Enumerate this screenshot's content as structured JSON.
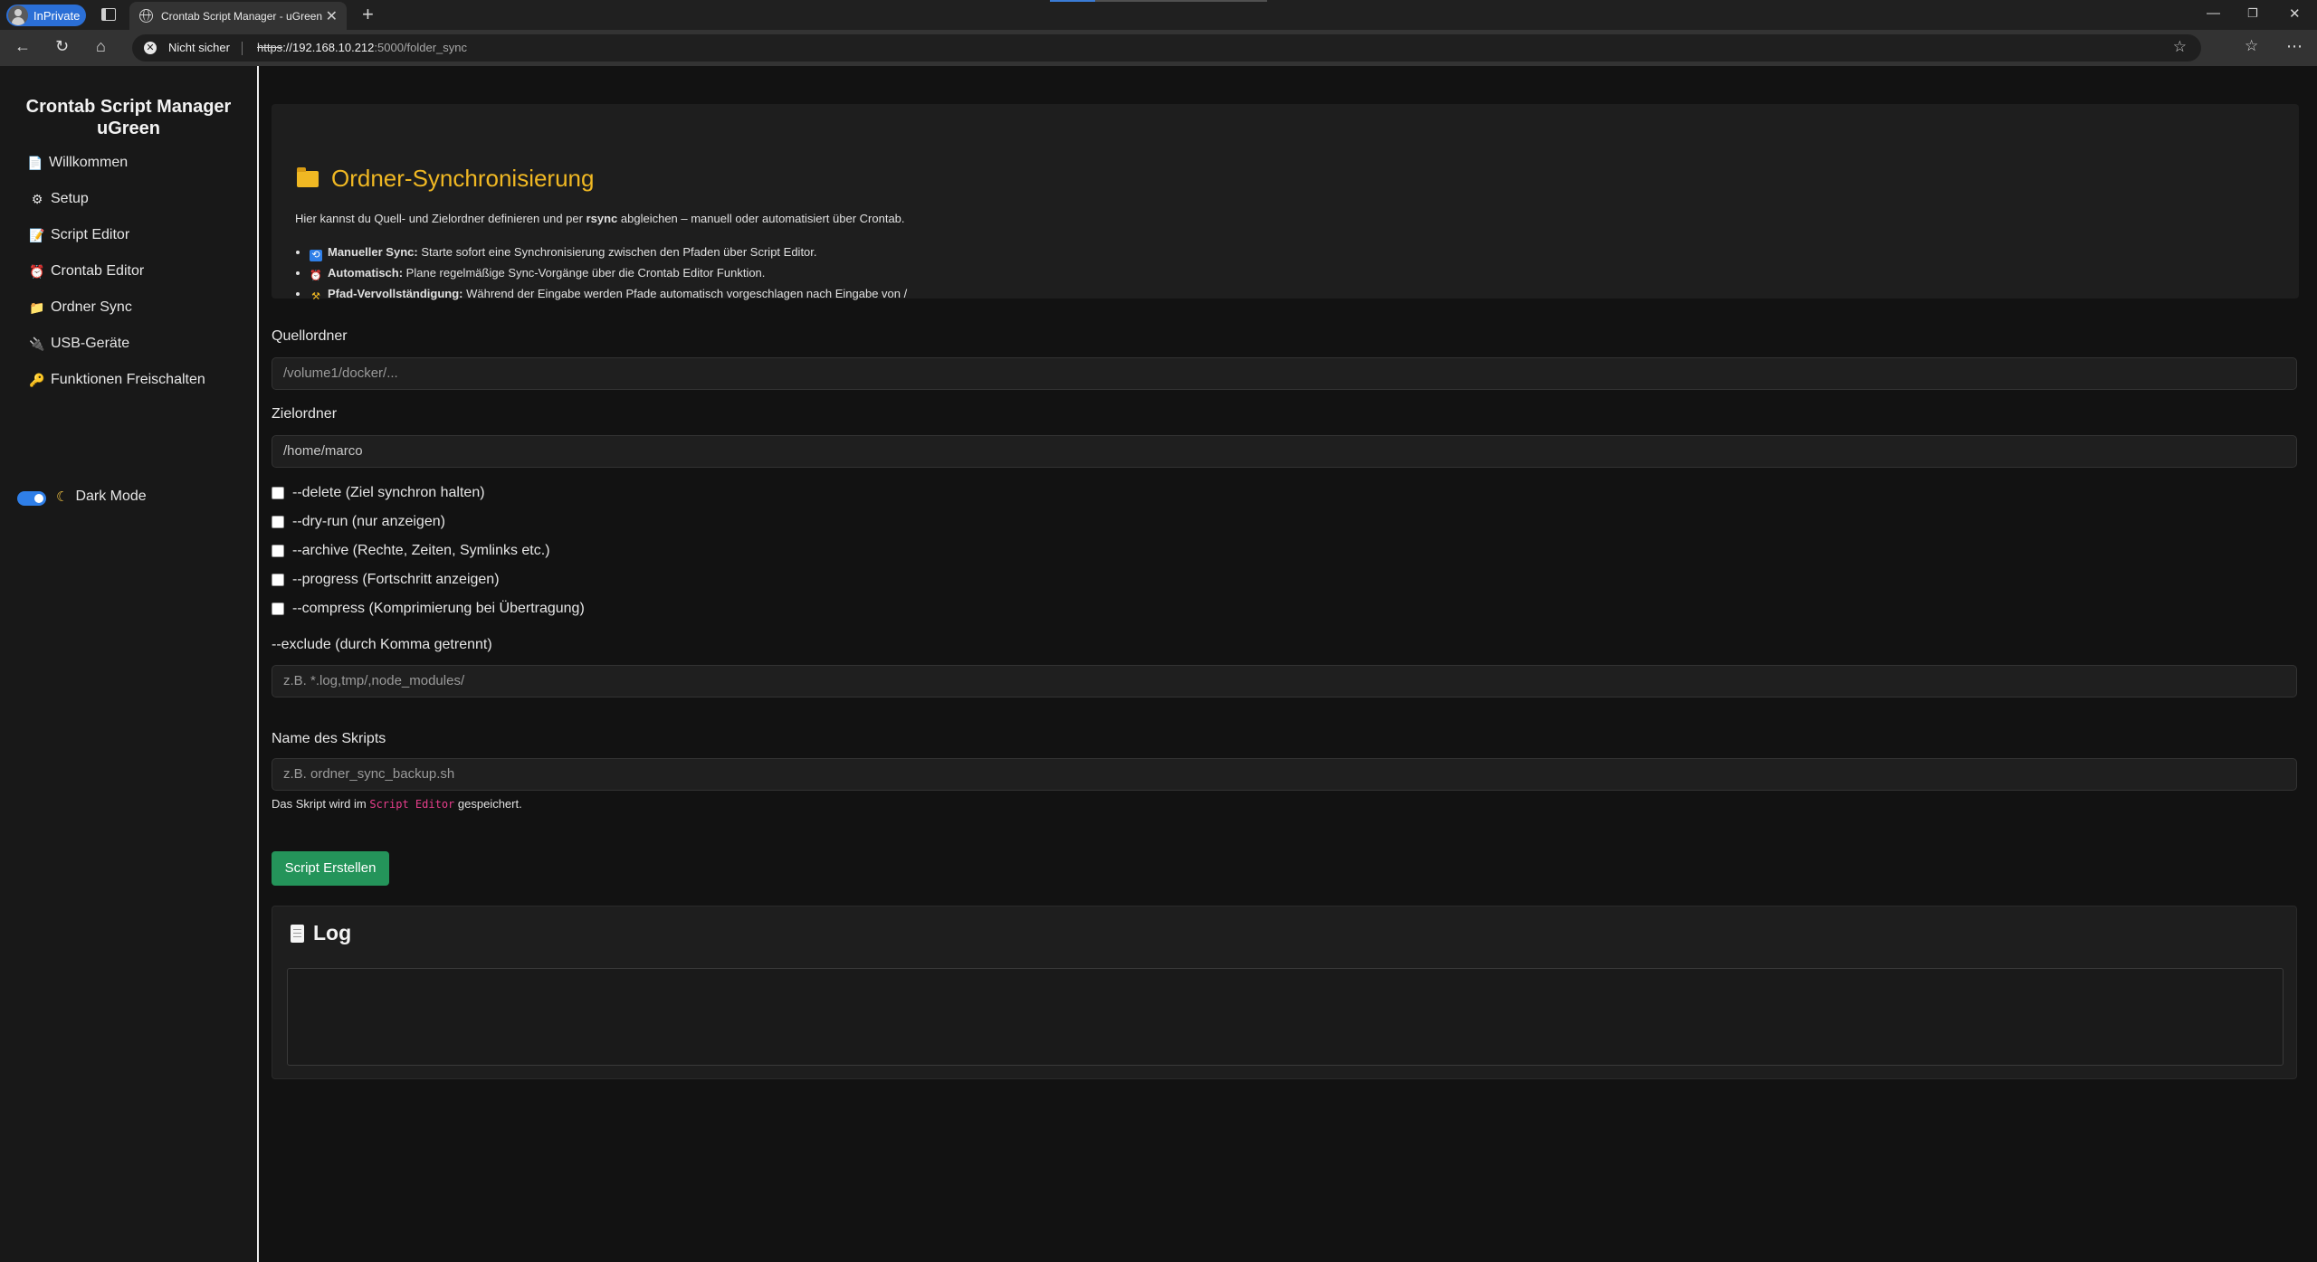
{
  "browser": {
    "inprivate_label": "InPrivate",
    "tab_title": "Crontab Script Manager - uGreen",
    "security_label": "Nicht sicher",
    "url_scheme": "https",
    "url_host": "://192.168.10.212",
    "url_path": ":5000/folder_sync"
  },
  "sidebar": {
    "title": "Crontab Script Manager uGreen",
    "items": [
      {
        "label": "Willkommen",
        "icon": "📄"
      },
      {
        "label": "Setup",
        "icon": "⚙"
      },
      {
        "label": "Script Editor",
        "icon": "📝"
      },
      {
        "label": "Crontab Editor",
        "icon": "⏰"
      },
      {
        "label": "Ordner Sync",
        "icon": "📁"
      },
      {
        "label": "USB-Geräte",
        "icon": "🔌"
      },
      {
        "label": "Funktionen Freischalten",
        "icon": "🔑"
      }
    ],
    "dark_mode_label": "Dark Mode"
  },
  "hero": {
    "title": "Ordner-Synchronisierung",
    "intro_pre": "Hier kannst du Quell- und Zielordner definieren und per ",
    "intro_bold": "rsync",
    "intro_post": " abgleichen – manuell oder automatisiert über Crontab.",
    "bullets": [
      {
        "bold": "Manueller Sync:",
        "text": " Starte sofort eine Synchronisierung zwischen den Pfaden über Script Editor."
      },
      {
        "bold": "Automatisch:",
        "text": " Plane regelmäßige Sync-Vorgänge über die Crontab Editor Funktion."
      },
      {
        "bold": "Pfad-Vervollständigung:",
        "text": " Während der Eingabe werden Pfade automatisch vorgeschlagen nach Eingabe von /"
      }
    ]
  },
  "form": {
    "source_label": "Quellordner",
    "source_placeholder": "/volume1/docker/...",
    "target_label": "Zielordner",
    "target_value": "/home/marco",
    "options": [
      "--delete (Ziel synchron halten)",
      "--dry-run (nur anzeigen)",
      "--archive (Rechte, Zeiten, Symlinks etc.)",
      "--progress (Fortschritt anzeigen)",
      "--compress (Komprimierung bei Übertragung)"
    ],
    "exclude_label": "--exclude (durch Komma getrennt)",
    "exclude_placeholder": "z.B. *.log,tmp/,node_modules/",
    "script_name_label": "Name des Skripts",
    "script_name_placeholder": "z.B. ordner_sync_backup.sh",
    "hint_pre": "Das Skript wird im ",
    "hint_code": "Script Editor",
    "hint_post": " gespeichert.",
    "create_button": "Script Erstellen"
  },
  "log": {
    "title": "Log",
    "content": ""
  },
  "colors": {
    "accent_title": "#f0b823",
    "button_green": "#24945a",
    "toggle_blue": "#2f7fe8",
    "code_pink": "#e83e8c"
  }
}
